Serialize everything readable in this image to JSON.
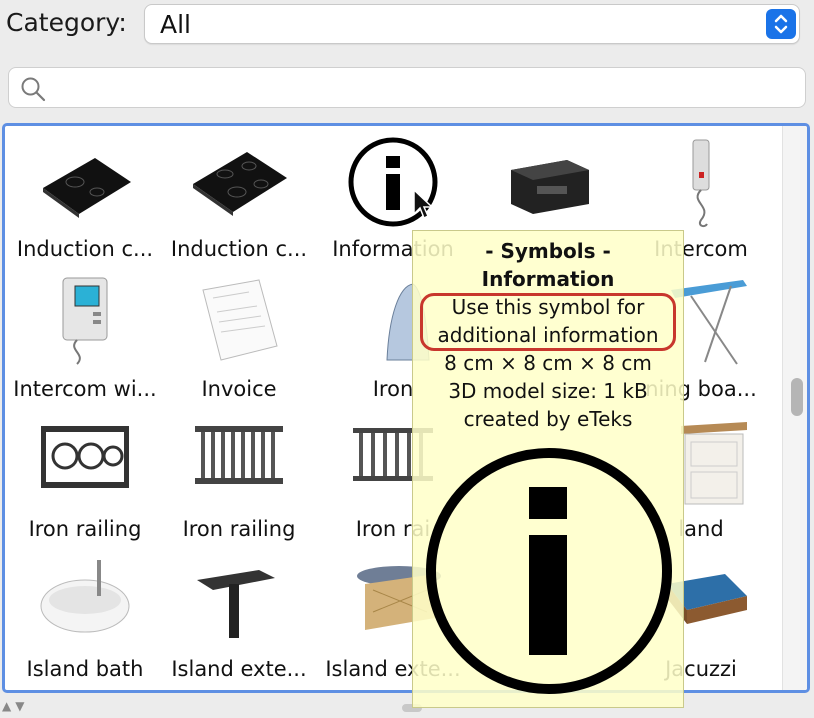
{
  "category": {
    "label": "Category:",
    "value": "All"
  },
  "search": {
    "placeholder": ""
  },
  "catalog": {
    "items": [
      {
        "label": "Induction c...",
        "icon": "induction-cooktop-icon"
      },
      {
        "label": "Induction c...",
        "icon": "induction-cooktop-icon"
      },
      {
        "label": "Information",
        "icon": "information-symbol-icon"
      },
      {
        "label": "",
        "icon": "printer-icon"
      },
      {
        "label": "Intercom",
        "icon": "intercom-handset-icon"
      },
      {
        "label": "Intercom wi...",
        "icon": "video-intercom-icon"
      },
      {
        "label": "Invoice",
        "icon": "invoice-document-icon"
      },
      {
        "label": "Iron",
        "icon": "clothes-iron-icon"
      },
      {
        "label": "",
        "icon": "item-hidden"
      },
      {
        "label": "ning boa...",
        "icon": "ironing-board-icon"
      },
      {
        "label": "Iron railing",
        "icon": "iron-railing-ornate-icon"
      },
      {
        "label": "Iron railing",
        "icon": "iron-railing-bars-icon"
      },
      {
        "label": "Iron rai",
        "icon": "iron-railing-icon"
      },
      {
        "label": "",
        "icon": "item-hidden"
      },
      {
        "label": "land",
        "icon": "kitchen-island-icon"
      },
      {
        "label": "Island bath",
        "icon": "island-bathtub-icon"
      },
      {
        "label": "Island exte...",
        "icon": "island-extension-icon"
      },
      {
        "label": "Island exte...",
        "icon": "island-extension-icon"
      },
      {
        "label": "",
        "icon": "jacket-icon"
      },
      {
        "label": "Jacuzzi",
        "icon": "jacuzzi-icon"
      }
    ]
  },
  "tooltip": {
    "title": "- Symbols -",
    "name": "Information",
    "description_line1": "Use this symbol for",
    "description_line2": "additional information",
    "size": "8 cm × 8 cm × 8 cm",
    "model_size": "3D model size: 1 kB",
    "creator": "created by eTeks",
    "highlight_color": "#c8372d",
    "background_color": "#ffffc8"
  },
  "colors": {
    "accent": "#1a73e8",
    "focus_ring": "#5e8fe3"
  }
}
